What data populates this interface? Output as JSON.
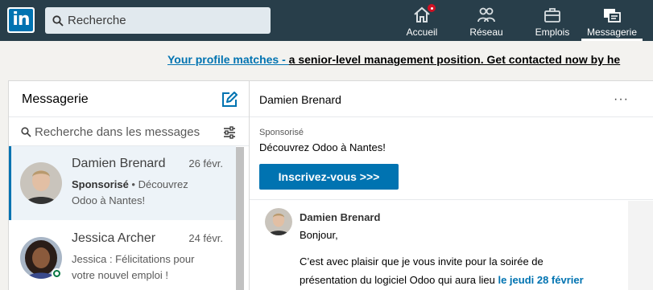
{
  "header": {
    "search_placeholder": "Recherche",
    "nav": [
      {
        "label": "Accueil",
        "icon": "home-icon",
        "badge": true
      },
      {
        "label": "Réseau",
        "icon": "network-icon"
      },
      {
        "label": "Emplois",
        "icon": "jobs-icon"
      },
      {
        "label": "Messagerie",
        "icon": "messaging-icon",
        "active": true
      }
    ]
  },
  "banner": {
    "link_text": "Your profile matches - ",
    "rest_text": "a senior-level management position. Get contacted now by he"
  },
  "messaging": {
    "title": "Messagerie",
    "search_placeholder": "Recherche dans les messages",
    "conversations": [
      {
        "name": "Damien Brenard",
        "date": "26 févr.",
        "snippet_bold": "Sponsorisé",
        "snippet_sep": " • ",
        "snippet_line1": "Découvrez",
        "snippet_line2": "Odoo à Nantes!"
      },
      {
        "name": "Jessica Archer",
        "date": "24 févr.",
        "snippet_line1": "Jessica : Félicitations pour",
        "snippet_line2": "votre nouvel emploi !",
        "online": true
      }
    ]
  },
  "thread": {
    "participant": "Damien Brenard",
    "more_label": "···",
    "sponsored_label": "Sponsorisé",
    "sponsored_title": "Découvrez Odoo à Nantes!",
    "cta_label": "Inscrivez-vous >>>",
    "message": {
      "sender": "Damien Brenard",
      "line1": "Bonjour,",
      "line2": "C’est avec plaisir que je vous invite pour la soirée de",
      "line3_start": "présentation du logiciel Odoo qui aura lieu ",
      "line3_link": "le jeudi 28 février"
    }
  },
  "colors": {
    "nav_bg": "#283e4a",
    "accent": "#0073b1",
    "badge": "#d11124",
    "online": "#057642"
  }
}
